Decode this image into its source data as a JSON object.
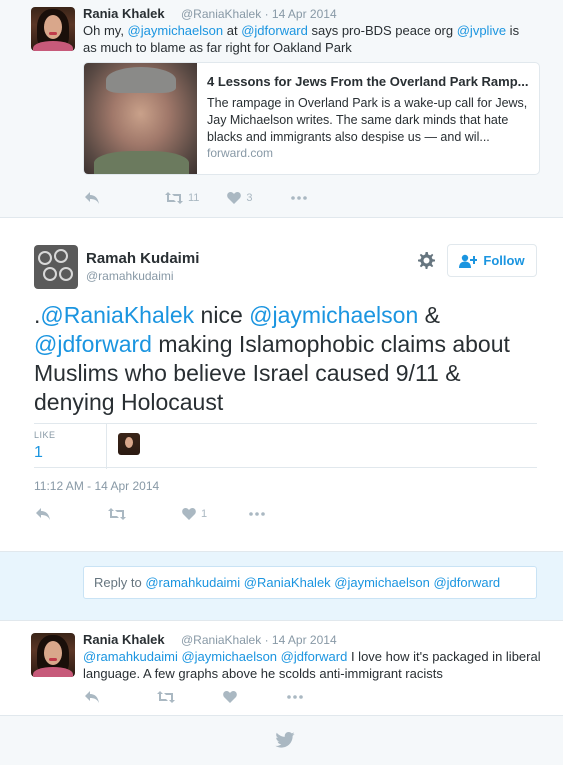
{
  "ancestor": {
    "name": "Rania Khalek",
    "handle": "@RaniaKhalek",
    "date": "· 14 Apr 2014",
    "text_pre": "Oh my, ",
    "mention1": "@jaymichaelson",
    "text_at": " at ",
    "mention2": "@jdforward",
    "text_mid": " says pro-BDS peace org ",
    "mention3": "@jvplive",
    "text_post": " is as much to blame as far right for Oakland Park",
    "card": {
      "title": "4 Lessons for Jews From the Overland Park Ramp...",
      "description": "The rampage in Overland Park is a wake-up call for Jews, Jay Michaelson writes. The same dark minds that hate blacks and immigrants also despise us — and wil...",
      "domain": "forward.com"
    },
    "retweets": "11",
    "likes": "3"
  },
  "main": {
    "name": "Ramah Kudaimi",
    "handle": "@ramahkudaimi",
    "follow_label": "Follow",
    "text_prefix": ".",
    "m1": "@RaniaKhalek",
    "t1": " nice ",
    "m2": "@jaymichaelson",
    "t2": " & ",
    "m3": "@jdforward",
    "t3": " making Islamophobic claims about Muslims who believe Israel caused 9/11 & denying Holocaust",
    "likes_label": "LIKE",
    "likes_count": "1",
    "timestamp": "11:12 AM - 14 Apr 2014",
    "action_likes": "1"
  },
  "reply_box": {
    "prefix": "Reply to ",
    "mentions": "@ramahkudaimi @RaniaKhalek @jaymichaelson @jdforward"
  },
  "reply": {
    "name": "Rania Khalek",
    "handle": "@RaniaKhalek",
    "date": "· 14 Apr 2014",
    "m1": "@ramahkudaimi",
    "m2": "@jaymichaelson",
    "m3": "@jdforward",
    "text": " I love how it's packaged in liberal language. A few graphs above he scolds anti-immigrant racists"
  },
  "colors": {
    "link": "#1b95e0",
    "muted": "#8899a6",
    "action": "#aab8c2"
  },
  "icons": [
    "reply-icon",
    "retweet-icon",
    "heart-icon",
    "more-icon",
    "gear-icon",
    "follow-person-icon",
    "twitter-bird-icon"
  ]
}
